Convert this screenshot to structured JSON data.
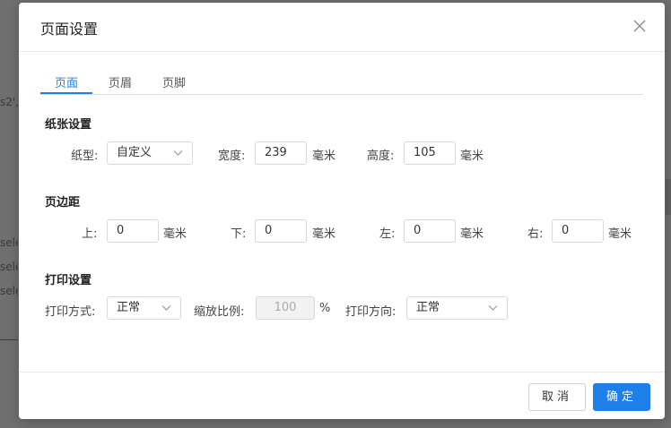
{
  "background": {
    "fragments": [
      "s2',",
      "sele",
      "sele",
      "sele"
    ]
  },
  "dialog": {
    "title": "页面设置",
    "close_icon": "close-icon",
    "tabs": [
      {
        "label": "页面",
        "active": true
      },
      {
        "label": "页眉",
        "active": false
      },
      {
        "label": "页脚",
        "active": false
      }
    ],
    "paper": {
      "title": "纸张设置",
      "type_label": "纸型:",
      "type_value": "自定义",
      "width_label": "宽度:",
      "width_value": "239",
      "width_unit": "毫米",
      "height_label": "高度:",
      "height_value": "105",
      "height_unit": "毫米"
    },
    "margins": {
      "title": "页边距",
      "top_label": "上:",
      "top_value": "0",
      "top_unit": "毫米",
      "bottom_label": "下:",
      "bottom_value": "0",
      "bottom_unit": "毫米",
      "left_label": "左:",
      "left_value": "0",
      "left_unit": "毫米",
      "right_label": "右:",
      "right_value": "0",
      "right_unit": "毫米"
    },
    "print": {
      "title": "打印设置",
      "mode_label": "打印方式:",
      "mode_value": "正常",
      "scale_label": "缩放比例:",
      "scale_value": "100",
      "scale_unit": "%",
      "direction_label": "打印方向:",
      "direction_value": "正常"
    },
    "footer": {
      "cancel_label": "取消",
      "ok_label": "确定"
    },
    "colors": {
      "accent": "#1f7fe8",
      "border": "#d9d9d9",
      "disabled_bg": "#f2f2f2"
    }
  }
}
